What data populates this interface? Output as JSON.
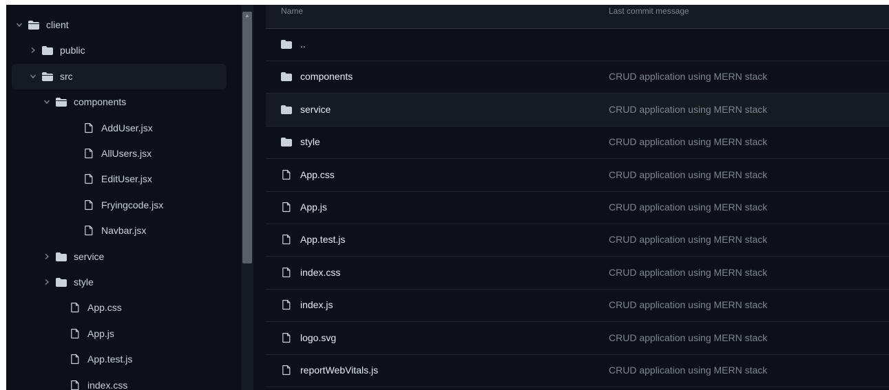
{
  "sidebar": {
    "items": [
      {
        "label": "client",
        "kind": "folder-open",
        "expanded": true,
        "depth": 0
      },
      {
        "label": "public",
        "kind": "folder",
        "expanded": false,
        "depth": 1
      },
      {
        "label": "src",
        "kind": "folder-open",
        "expanded": true,
        "depth": 1,
        "selected": true
      },
      {
        "label": "components",
        "kind": "folder-open",
        "expanded": true,
        "depth": 2
      },
      {
        "label": "AddUser.jsx",
        "kind": "file",
        "depth": 3
      },
      {
        "label": "AllUsers.jsx",
        "kind": "file",
        "depth": 3
      },
      {
        "label": "EditUser.jsx",
        "kind": "file",
        "depth": 3
      },
      {
        "label": "Fryingcode.jsx",
        "kind": "file",
        "depth": 3
      },
      {
        "label": "Navbar.jsx",
        "kind": "file",
        "depth": 3
      },
      {
        "label": "service",
        "kind": "folder",
        "expanded": false,
        "depth": 2
      },
      {
        "label": "style",
        "kind": "folder",
        "expanded": false,
        "depth": 2
      },
      {
        "label": "App.css",
        "kind": "file",
        "depth": 2
      },
      {
        "label": "App.js",
        "kind": "file",
        "depth": 2
      },
      {
        "label": "App.test.js",
        "kind": "file",
        "depth": 2
      },
      {
        "label": "index.css",
        "kind": "file",
        "depth": 2
      }
    ]
  },
  "table": {
    "header": {
      "name": "Name",
      "message": "Last commit message"
    },
    "rows": [
      {
        "name": "..",
        "kind": "folder",
        "message": ""
      },
      {
        "name": "components",
        "kind": "folder",
        "message": "CRUD application using MERN stack"
      },
      {
        "name": "service",
        "kind": "folder",
        "message": "CRUD application using MERN stack",
        "hover": true
      },
      {
        "name": "style",
        "kind": "folder",
        "message": "CRUD application using MERN stack"
      },
      {
        "name": "App.css",
        "kind": "file",
        "message": "CRUD application using MERN stack"
      },
      {
        "name": "App.js",
        "kind": "file",
        "message": "CRUD application using MERN stack"
      },
      {
        "name": "App.test.js",
        "kind": "file",
        "message": "CRUD application using MERN stack"
      },
      {
        "name": "index.css",
        "kind": "file",
        "message": "CRUD application using MERN stack"
      },
      {
        "name": "index.js",
        "kind": "file",
        "message": "CRUD application using MERN stack"
      },
      {
        "name": "logo.svg",
        "kind": "file",
        "message": "CRUD application using MERN stack"
      },
      {
        "name": "reportWebVitals.js",
        "kind": "file",
        "message": "CRUD application using MERN stack"
      }
    ]
  },
  "colors": {
    "background": "#0d1117",
    "header": "#161b22",
    "text": "#e6edf3",
    "muted": "#7d8590",
    "folder": "#c9d1d9"
  }
}
